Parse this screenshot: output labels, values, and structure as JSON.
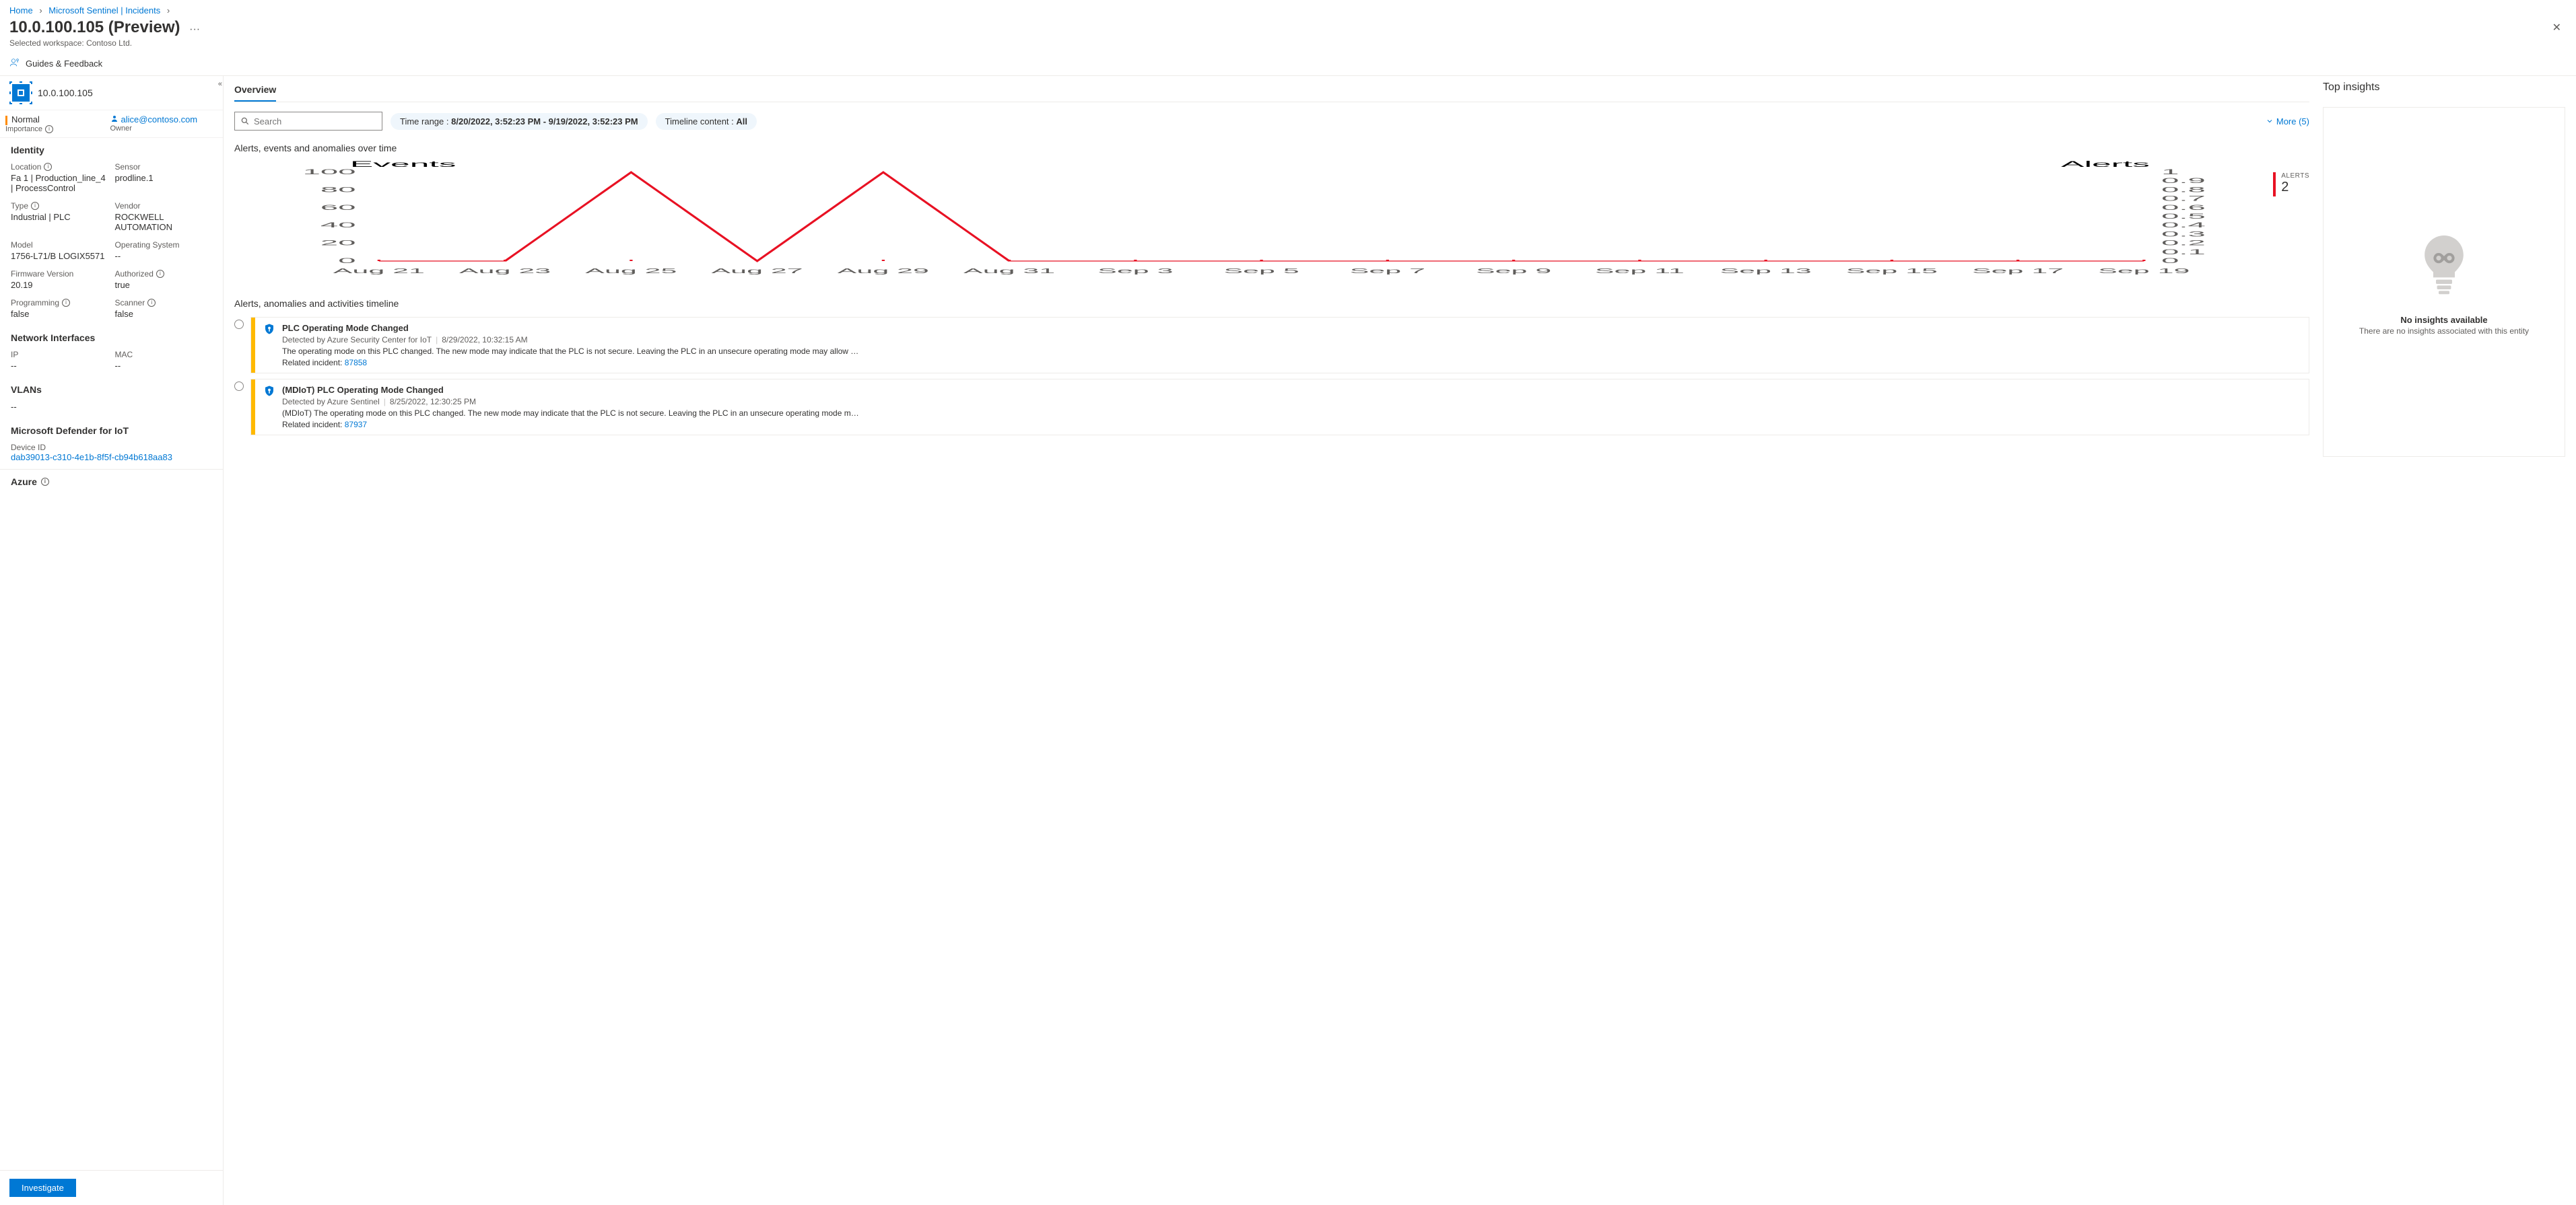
{
  "breadcrumb": [
    {
      "label": "Home"
    },
    {
      "label": "Microsoft Sentinel | Incidents"
    }
  ],
  "header": {
    "title": "10.0.100.105 (Preview)",
    "workspace_label": "Selected workspace:",
    "workspace_value": "Contoso Ltd."
  },
  "guides_label": "Guides & Feedback",
  "sidebar": {
    "entity_title": "10.0.100.105",
    "severity": "Normal",
    "severity_label": "Importance",
    "owner": "alice@contoso.com",
    "owner_label": "Owner",
    "identity_title": "Identity",
    "identity": {
      "location_k": "Location",
      "location_v": "Fa 1 | Production_line_4 | ProcessControl",
      "sensor_k": "Sensor",
      "sensor_v": "prodline.1",
      "type_k": "Type",
      "type_v": "Industrial | PLC",
      "vendor_k": "Vendor",
      "vendor_v": "ROCKWELL AUTOMATION",
      "model_k": "Model",
      "model_v": "1756-L71/B LOGIX5571",
      "os_k": "Operating System",
      "os_v": "--",
      "fw_k": "Firmware Version",
      "fw_v": "20.19",
      "auth_k": "Authorized",
      "auth_v": "true",
      "prog_k": "Programming",
      "prog_v": "false",
      "scan_k": "Scanner",
      "scan_v": "false"
    },
    "net_title": "Network Interfaces",
    "net": {
      "ip_k": "IP",
      "ip_v": "--",
      "mac_k": "MAC",
      "mac_v": "--"
    },
    "vlans_title": "VLANs",
    "vlans_v": "--",
    "mdiot_title": "Microsoft Defender for IoT",
    "mdiot_device_k": "Device ID",
    "mdiot_device_v": "dab39013-c310-4e1b-8f5f-cb94b618aa83",
    "azure_title": "Azure",
    "investigate_btn": "Investigate"
  },
  "tabs": {
    "overview": "Overview"
  },
  "search": {
    "placeholder": "Search"
  },
  "filters": {
    "timerange_label": "Time range :",
    "timerange_value": "8/20/2022, 3:52:23 PM - 9/19/2022, 3:52:23 PM",
    "content_label": "Timeline content :",
    "content_value": "All",
    "more_label": "More (5)"
  },
  "chart_title": "Alerts, events and anomalies over time",
  "chart_data": {
    "type": "line",
    "left": {
      "label": "Events",
      "ylim": [
        0,
        100
      ],
      "yticks": [
        0,
        20,
        40,
        60,
        80,
        100
      ]
    },
    "right": {
      "label": "Alerts",
      "ylim": [
        0,
        1
      ],
      "yticks": [
        0,
        0.1,
        0.2,
        0.3,
        0.4,
        0.5,
        0.6,
        0.7,
        0.8,
        0.9,
        1
      ]
    },
    "categories": [
      "Aug 21",
      "Aug 23",
      "Aug 25",
      "Aug 27",
      "Aug 29",
      "Aug 31",
      "Sep 3",
      "Sep 5",
      "Sep 7",
      "Sep 9",
      "Sep 11",
      "Sep 13",
      "Sep 15",
      "Sep 17",
      "Sep 19"
    ],
    "series": [
      {
        "name": "Events",
        "axis": "left",
        "values": [
          0,
          0,
          100,
          0,
          100,
          0,
          0,
          0,
          0,
          0,
          0,
          0,
          0,
          0,
          0
        ]
      }
    ]
  },
  "alerts_badge": {
    "label": "ALERTS",
    "count": "2"
  },
  "timeline_title": "Alerts, anomalies and activities timeline",
  "timeline": [
    {
      "title": "PLC Operating Mode Changed",
      "source": "Detected by Azure Security Center for IoT",
      "time": "8/29/2022, 10:32:15 AM",
      "desc": "The operating mode on this PLC changed. The new mode may indicate that the PLC is not secure. Leaving the PLC in an unsecure operating mode may allow …",
      "related_label": "Related incident:",
      "related_id": "87858"
    },
    {
      "title": "(MDIoT) PLC Operating Mode Changed",
      "source": "Detected by Azure Sentinel",
      "time": "8/25/2022, 12:30:25 PM",
      "desc": "(MDIoT) The operating mode on this PLC changed. The new mode may indicate that the PLC is not secure. Leaving the PLC in an unsecure operating mode m…",
      "related_label": "Related incident:",
      "related_id": "87937"
    }
  ],
  "insights": {
    "title": "Top insights",
    "empty_title": "No insights available",
    "empty_sub": "There are no insights associated with this entity"
  }
}
